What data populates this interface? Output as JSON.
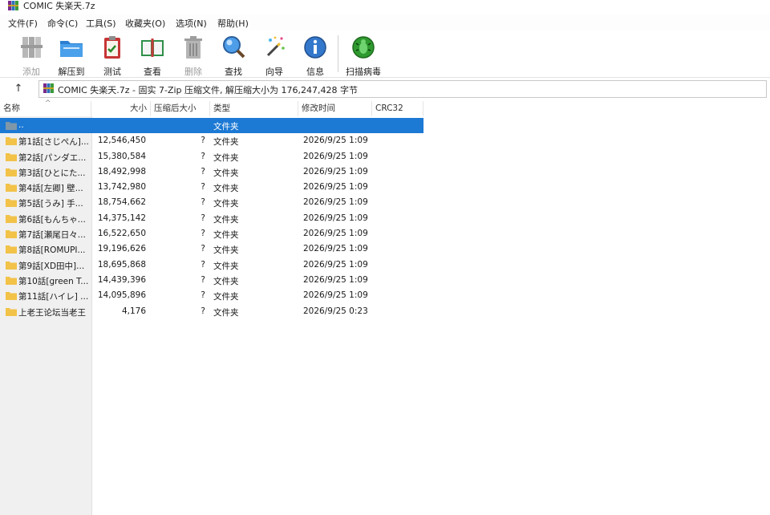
{
  "window": {
    "title": "COMIC 失楽天.7z"
  },
  "menu": [
    "文件(F)",
    "命令(C)",
    "工具(S)",
    "收藏夹(O)",
    "选项(N)",
    "帮助(H)"
  ],
  "toolbar": {
    "add": "添加",
    "extract_to": "解压到",
    "test": "测试",
    "view": "查看",
    "delete": "删除",
    "find": "查找",
    "wizard": "向导",
    "info": "信息",
    "virus_scan": "扫描病毒"
  },
  "address": {
    "path": "COMIC 失楽天.7z - 固实 7-Zip 压缩文件, 解压缩大小为 176,247,428 字节"
  },
  "columns": {
    "name": "名称",
    "size": "大小",
    "packed": "压缩后大小",
    "type": "类型",
    "modified": "修改时间",
    "crc": "CRC32"
  },
  "parent_row": {
    "name": "..",
    "type": "文件夹"
  },
  "rows": [
    {
      "name": "第1話[さじぺん]...",
      "size": "12,546,450",
      "packed": "?",
      "type": "文件夹",
      "modified": "2026/9/25 1:09"
    },
    {
      "name": "第2話[パンダエ...",
      "size": "15,380,584",
      "packed": "?",
      "type": "文件夹",
      "modified": "2026/9/25 1:09"
    },
    {
      "name": "第3話[ひとにた...",
      "size": "18,492,998",
      "packed": "?",
      "type": "文件夹",
      "modified": "2026/9/25 1:09"
    },
    {
      "name": "第4話[左卿] 壁...",
      "size": "13,742,980",
      "packed": "?",
      "type": "文件夹",
      "modified": "2026/9/25 1:09"
    },
    {
      "name": "第5話[うみ] 手...",
      "size": "18,754,662",
      "packed": "?",
      "type": "文件夹",
      "modified": "2026/9/25 1:09"
    },
    {
      "name": "第6話[もんちゃ...",
      "size": "14,375,142",
      "packed": "?",
      "type": "文件夹",
      "modified": "2026/9/25 1:09"
    },
    {
      "name": "第7話[瀬尾日々...",
      "size": "16,522,650",
      "packed": "?",
      "type": "文件夹",
      "modified": "2026/9/25 1:09"
    },
    {
      "name": "第8話[ROMUPI...",
      "size": "19,196,626",
      "packed": "?",
      "type": "文件夹",
      "modified": "2026/9/25 1:09"
    },
    {
      "name": "第9話[XD田中]...",
      "size": "18,695,868",
      "packed": "?",
      "type": "文件夹",
      "modified": "2026/9/25 1:09"
    },
    {
      "name": "第10話[green T...",
      "size": "14,439,396",
      "packed": "?",
      "type": "文件夹",
      "modified": "2026/9/25 1:09"
    },
    {
      "name": "第11話[ハイレ] ...",
      "size": "14,095,896",
      "packed": "?",
      "type": "文件夹",
      "modified": "2026/9/25 1:09"
    },
    {
      "name": "上老王论坛当老王",
      "size": "4,176",
      "packed": "?",
      "type": "文件夹",
      "modified": "2026/9/25 0:23"
    }
  ],
  "colors": {
    "selection": "#1c79d4",
    "folder": "#f2c249"
  },
  "icons": {
    "add": "archive-books-icon",
    "extract_to": "folder-extract-icon",
    "test": "clipboard-check-icon",
    "view": "open-book-icon",
    "delete": "trash-can-icon",
    "find": "magnifier-icon",
    "wizard": "magic-wand-icon",
    "info": "info-circle-icon",
    "virus_scan": "bug-scan-icon"
  }
}
